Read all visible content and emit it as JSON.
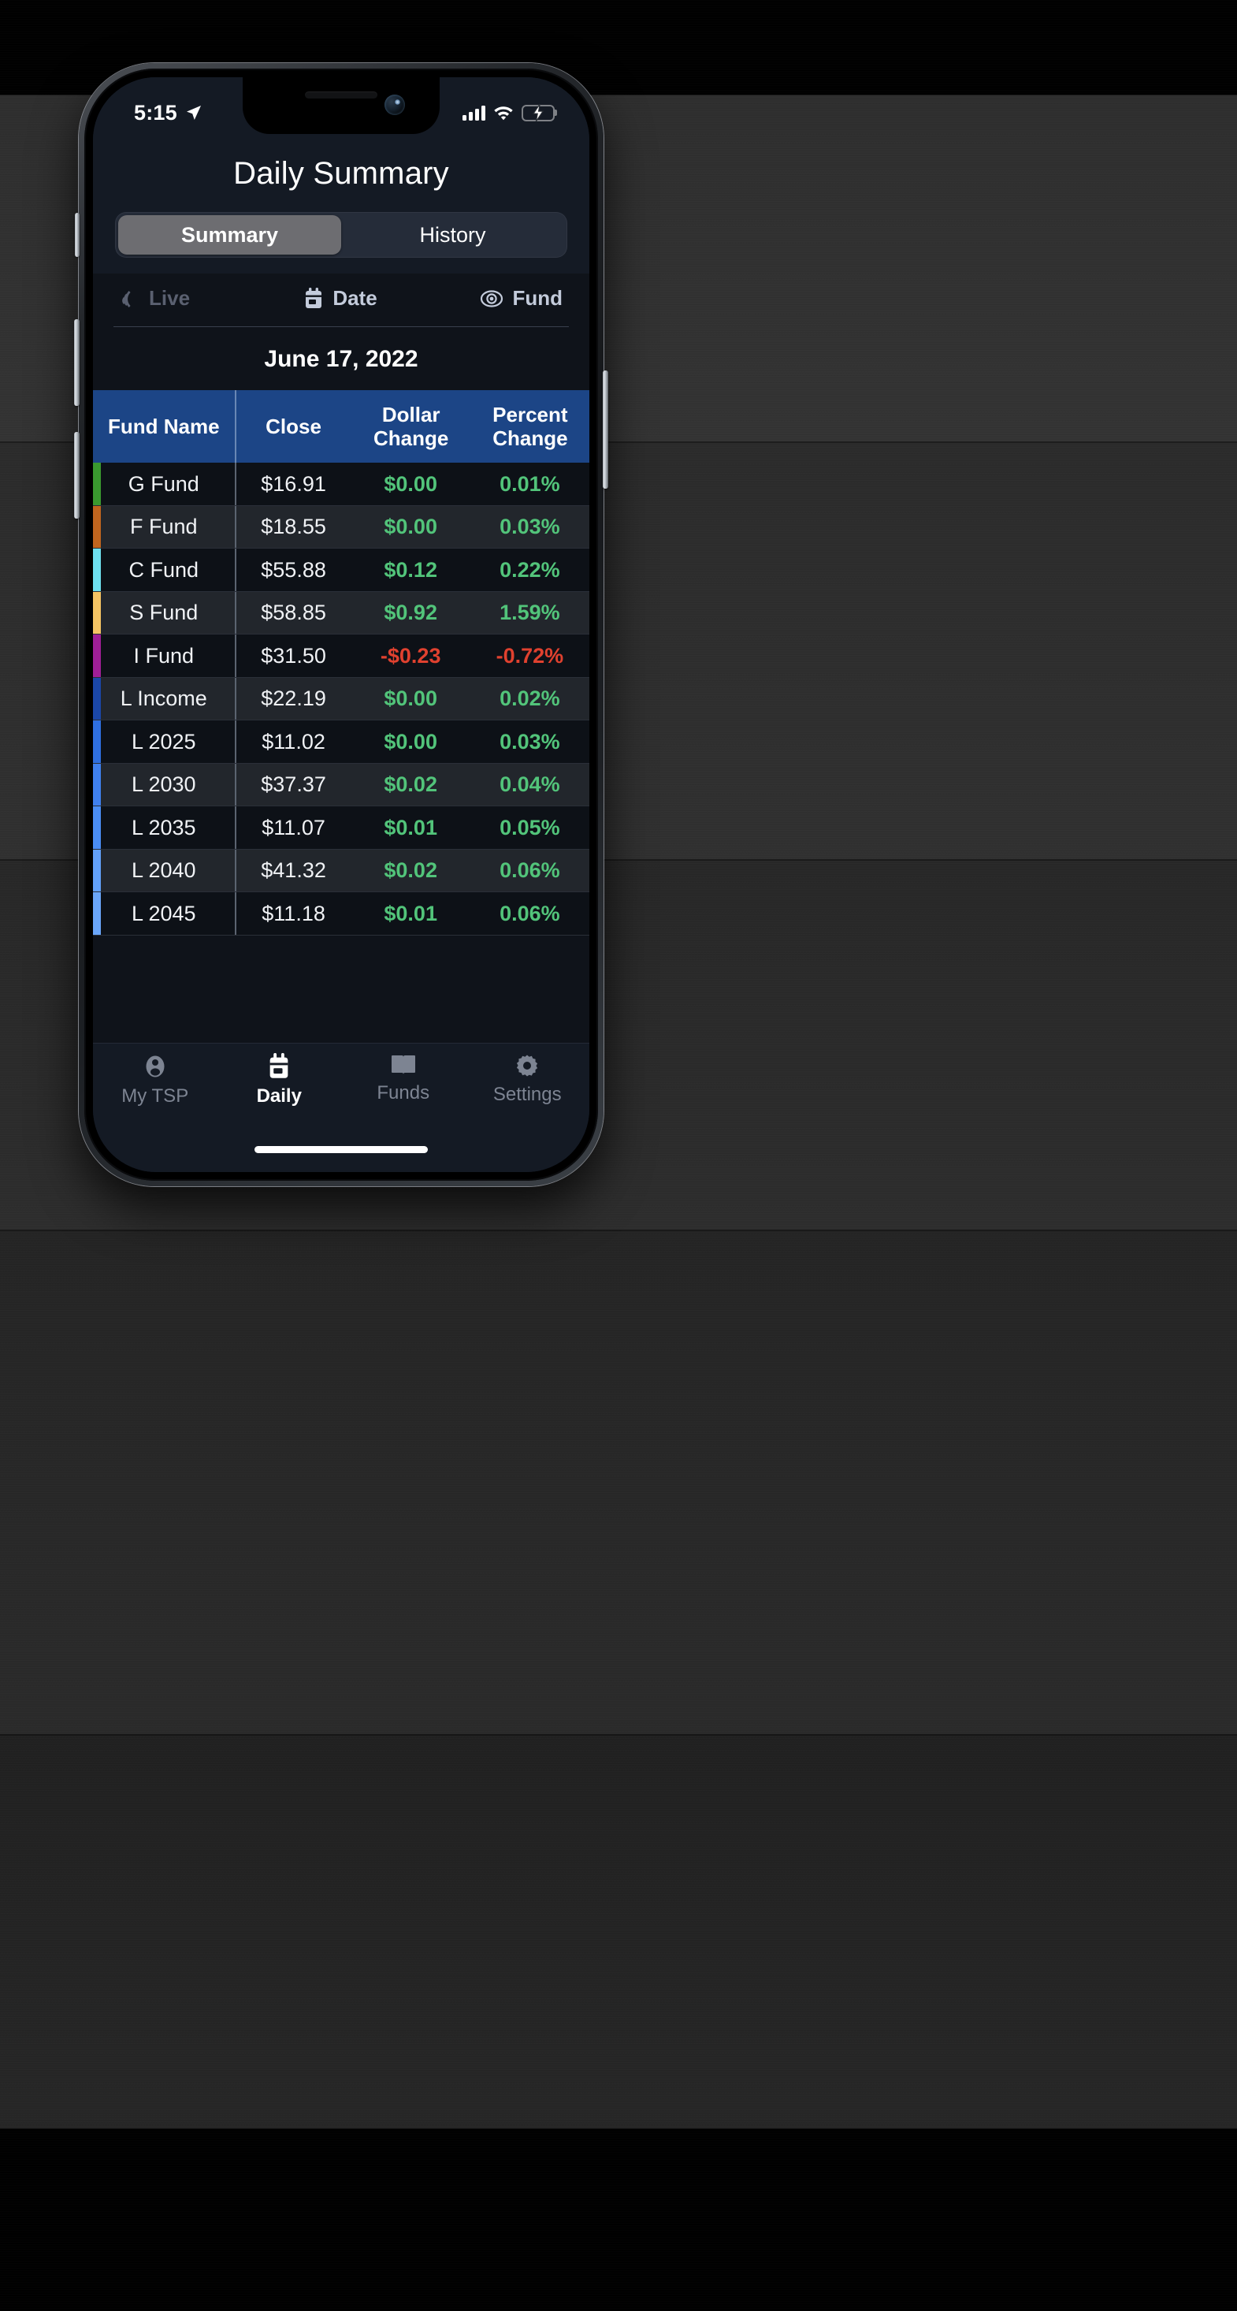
{
  "status_bar": {
    "time": "5:15",
    "location_icon": "location-arrow-icon",
    "signal_icon": "cellular-signal-icon",
    "wifi_icon": "wifi-icon",
    "battery_icon": "battery-charging-icon",
    "battery_level_percent": 72
  },
  "nav": {
    "title": "Daily Summary"
  },
  "segmented": {
    "options": [
      {
        "label": "Summary",
        "selected": true
      },
      {
        "label": "History",
        "selected": false
      }
    ]
  },
  "toolbar": {
    "items": [
      {
        "label": "Live",
        "icon": "live-broadcast-icon",
        "disabled": true
      },
      {
        "label": "Date",
        "icon": "calendar-icon",
        "disabled": false
      },
      {
        "label": "Fund",
        "icon": "eye-icon",
        "disabled": false
      }
    ]
  },
  "date_line": "June 17, 2022",
  "colors": {
    "header_blue": "#1c4586",
    "positive_green": "#52c47a",
    "negative_red": "#e0412f",
    "screen_bg": "#0f131a",
    "nav_bg": "#141a24",
    "segment_selected": "#6d6d71"
  },
  "chart_data": {
    "type": "table",
    "title": "Daily Summary",
    "subtitle": "June 17, 2022",
    "columns": [
      "Fund Name",
      "Close",
      "Dollar Change",
      "Percent Change"
    ],
    "rows": [
      {
        "fund": "G Fund",
        "close": "$16.91",
        "dollar_change": "$0.00",
        "percent_change": "0.01%",
        "direction": "pos",
        "color": "#3a9a2f"
      },
      {
        "fund": "F Fund",
        "close": "$18.55",
        "dollar_change": "$0.00",
        "percent_change": "0.03%",
        "direction": "pos",
        "color": "#c0651e"
      },
      {
        "fund": "C Fund",
        "close": "$55.88",
        "dollar_change": "$0.12",
        "percent_change": "0.22%",
        "direction": "pos",
        "color": "#6ee0ee"
      },
      {
        "fund": "S Fund",
        "close": "$58.85",
        "dollar_change": "$0.92",
        "percent_change": "1.59%",
        "direction": "pos",
        "color": "#f5c463"
      },
      {
        "fund": "I Fund",
        "close": "$31.50",
        "dollar_change": "-$0.23",
        "percent_change": "-0.72%",
        "direction": "neg",
        "color": "#a01f97"
      },
      {
        "fund": "L Income",
        "close": "$22.19",
        "dollar_change": "$0.00",
        "percent_change": "0.02%",
        "direction": "pos",
        "color": "#1b47a8"
      },
      {
        "fund": "L 2025",
        "close": "$11.02",
        "dollar_change": "$0.00",
        "percent_change": "0.03%",
        "direction": "pos",
        "color": "#2f6fe0"
      },
      {
        "fund": "L 2030",
        "close": "$37.37",
        "dollar_change": "$0.02",
        "percent_change": "0.04%",
        "direction": "pos",
        "color": "#3f80ef"
      },
      {
        "fund": "L 2035",
        "close": "$11.07",
        "dollar_change": "$0.01",
        "percent_change": "0.05%",
        "direction": "pos",
        "color": "#4a8df5"
      },
      {
        "fund": "L 2040",
        "close": "$41.32",
        "dollar_change": "$0.02",
        "percent_change": "0.06%",
        "direction": "pos",
        "color": "#62a0f8"
      },
      {
        "fund": "L 2045",
        "close": "$11.18",
        "dollar_change": "$0.01",
        "percent_change": "0.06%",
        "direction": "pos",
        "color": "#6aa6f9"
      }
    ]
  },
  "tabbar": {
    "items": [
      {
        "label": "My TSP",
        "icon": "person-icon",
        "active": false
      },
      {
        "label": "Daily",
        "icon": "calendar-icon",
        "active": true
      },
      {
        "label": "Funds",
        "icon": "book-icon",
        "active": false
      },
      {
        "label": "Settings",
        "icon": "gear-icon",
        "active": false
      }
    ]
  }
}
